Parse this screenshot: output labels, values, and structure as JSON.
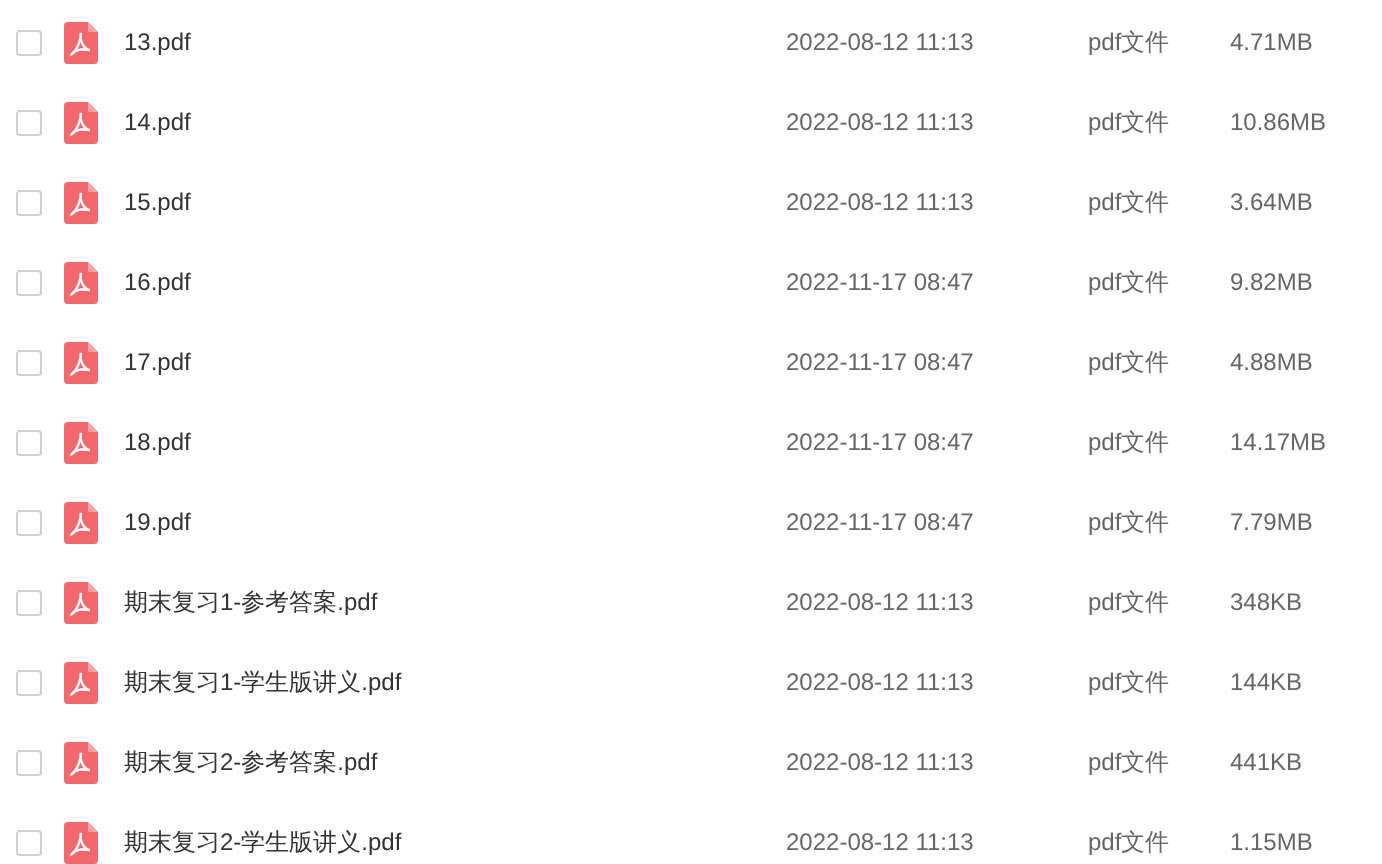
{
  "files": [
    {
      "name": "13.pdf",
      "modified": "2022-08-12 11:13",
      "type": "pdf文件",
      "size": "4.71MB",
      "checked": false
    },
    {
      "name": "14.pdf",
      "modified": "2022-08-12 11:13",
      "type": "pdf文件",
      "size": "10.86MB",
      "checked": false
    },
    {
      "name": "15.pdf",
      "modified": "2022-08-12 11:13",
      "type": "pdf文件",
      "size": "3.64MB",
      "checked": false
    },
    {
      "name": "16.pdf",
      "modified": "2022-11-17 08:47",
      "type": "pdf文件",
      "size": "9.82MB",
      "checked": false
    },
    {
      "name": "17.pdf",
      "modified": "2022-11-17 08:47",
      "type": "pdf文件",
      "size": "4.88MB",
      "checked": false
    },
    {
      "name": "18.pdf",
      "modified": "2022-11-17 08:47",
      "type": "pdf文件",
      "size": "14.17MB",
      "checked": false
    },
    {
      "name": "19.pdf",
      "modified": "2022-11-17 08:47",
      "type": "pdf文件",
      "size": "7.79MB",
      "checked": false
    },
    {
      "name": "期末复习1-参考答案.pdf",
      "modified": "2022-08-12 11:13",
      "type": "pdf文件",
      "size": "348KB",
      "checked": false
    },
    {
      "name": "期末复习1-学生版讲义.pdf",
      "modified": "2022-08-12 11:13",
      "type": "pdf文件",
      "size": "144KB",
      "checked": false
    },
    {
      "name": "期末复习2-参考答案.pdf",
      "modified": "2022-08-12 11:13",
      "type": "pdf文件",
      "size": "441KB",
      "checked": false
    },
    {
      "name": "期末复习2-学生版讲义.pdf",
      "modified": "2022-08-12 11:13",
      "type": "pdf文件",
      "size": "1.15MB",
      "checked": false
    }
  ]
}
